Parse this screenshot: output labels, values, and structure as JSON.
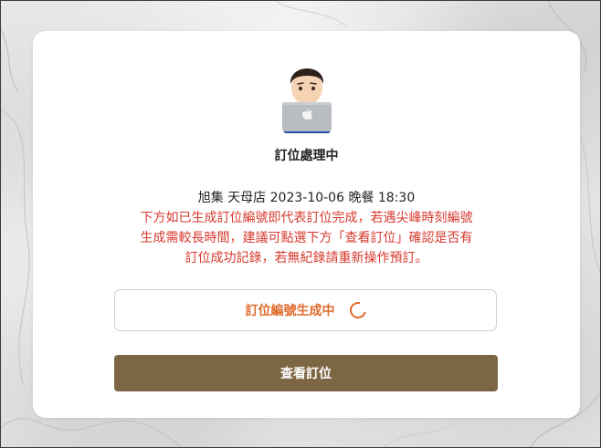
{
  "status": {
    "title": "訂位處理中",
    "booking_info": "旭集 天母店 2023-10-06 晚餐 18:30",
    "notice_lines": [
      "下方如已生成訂位編號即代表訂位完成，若遇尖峰時刻編號",
      "生成需較長時間，建議可點選下方「查看訂位」確認是否有",
      "訂位成功記錄，若無紀錄請重新操作預訂。"
    ],
    "generating_label": "訂位編號生成中"
  },
  "actions": {
    "view_booking_label": "查看訂位"
  },
  "icons": {
    "illustration": "technologist-with-laptop-icon",
    "loading": "loading-spinner-icon"
  },
  "colors": {
    "notice": "#d63a2f",
    "accent": "#e06a2c",
    "button": "#7d6644"
  }
}
